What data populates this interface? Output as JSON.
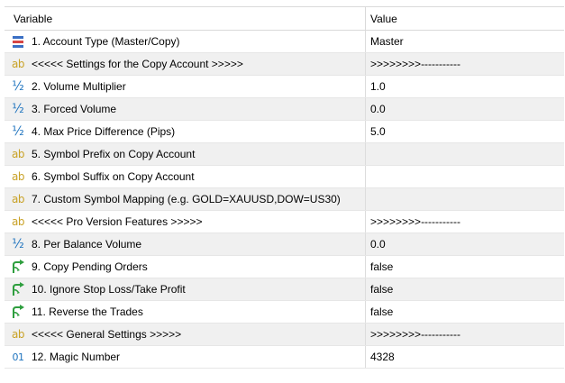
{
  "header": {
    "variable": "Variable",
    "value": "Value"
  },
  "rows": [
    {
      "icon": "enum-icon",
      "label": "1. Account Type (Master/Copy)",
      "value": "Master"
    },
    {
      "icon": "string-icon",
      "label": "<<<<< Settings for the Copy Account >>>>>",
      "value": ">>>>>>>>-----------"
    },
    {
      "icon": "double-icon",
      "label": "2. Volume Multiplier",
      "value": "1.0"
    },
    {
      "icon": "double-icon",
      "label": "3. Forced Volume",
      "value": "0.0"
    },
    {
      "icon": "double-icon",
      "label": "4. Max Price Difference (Pips)",
      "value": "5.0"
    },
    {
      "icon": "string-icon",
      "label": "5. Symbol Prefix on Copy Account",
      "value": ""
    },
    {
      "icon": "string-icon",
      "label": "6. Symbol Suffix on Copy Account",
      "value": ""
    },
    {
      "icon": "string-icon",
      "label": "7. Custom Symbol Mapping (e.g. GOLD=XAUUSD,DOW=US30)",
      "value": ""
    },
    {
      "icon": "string-icon",
      "label": "<<<<< Pro Version Features >>>>>",
      "value": ">>>>>>>>-----------"
    },
    {
      "icon": "double-icon",
      "label": "8. Per Balance Volume",
      "value": "0.0"
    },
    {
      "icon": "bool-icon",
      "label": "9. Copy Pending Orders",
      "value": "false"
    },
    {
      "icon": "bool-icon",
      "label": "10. Ignore Stop Loss/Take Profit",
      "value": "false"
    },
    {
      "icon": "bool-icon",
      "label": "11. Reverse the Trades",
      "value": "false"
    },
    {
      "icon": "string-icon",
      "label": "<<<<< General Settings >>>>>",
      "value": ">>>>>>>>-----------"
    },
    {
      "icon": "integer-icon",
      "label": "12. Magic Number",
      "value": "4328"
    }
  ],
  "icons": {
    "string-icon": "ab",
    "double-icon": "½",
    "integer-icon": "01"
  },
  "colors": {
    "string_icon": "#c9a227",
    "numeric_icon": "#1e73be",
    "bool_icon": "#2e9e3e",
    "row_shade": "#f0f0f0",
    "grid_line": "#d9d9d9"
  }
}
